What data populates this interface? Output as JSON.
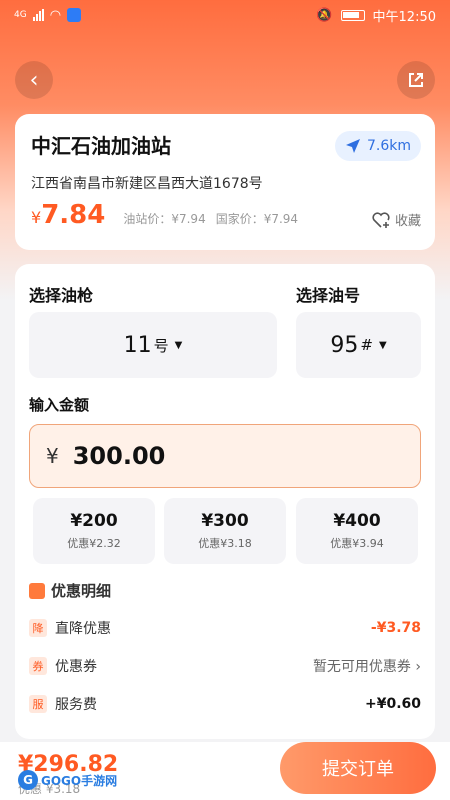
{
  "status_bar": {
    "network": "4G",
    "time": "中午12:50"
  },
  "station": {
    "name": "中汇石油加油站",
    "distance": "7.6km",
    "address": "江西省南昌市新建区昌西大道1678号",
    "price_symbol": "¥",
    "price": "7.84",
    "station_price": "油站价：¥7.94",
    "national_price": "国家价：¥7.94",
    "favorite_label": "收藏"
  },
  "fuel": {
    "gun_title": "选择油枪",
    "gun_value": "11",
    "gun_suffix": "号",
    "grade_title": "选择油号",
    "grade_value": "95",
    "grade_suffix": "#"
  },
  "amount": {
    "title": "输入金额",
    "currency": "¥",
    "value": "300.00",
    "presets": [
      {
        "amount": "¥200",
        "discount": "优惠¥2.32"
      },
      {
        "amount": "¥300",
        "discount": "优惠¥3.18"
      },
      {
        "amount": "¥400",
        "discount": "优惠¥3.94"
      }
    ]
  },
  "discount_detail": {
    "title": "优惠明细",
    "rows": [
      {
        "tag": "降",
        "label": "直降优惠",
        "value": "-¥3.78"
      },
      {
        "tag": "券",
        "label": "优惠券",
        "value": "暂无可用优惠券"
      },
      {
        "tag": "服",
        "label": "服务费",
        "value": "+¥0.60"
      }
    ]
  },
  "footer": {
    "total": "¥296.82",
    "total_sub": "优惠 ¥3.18",
    "submit_label": "提交订单",
    "watermark": "GOGO手游网"
  },
  "colors": {
    "accent": "#ff5a22",
    "blue": "#2f6fe0"
  }
}
